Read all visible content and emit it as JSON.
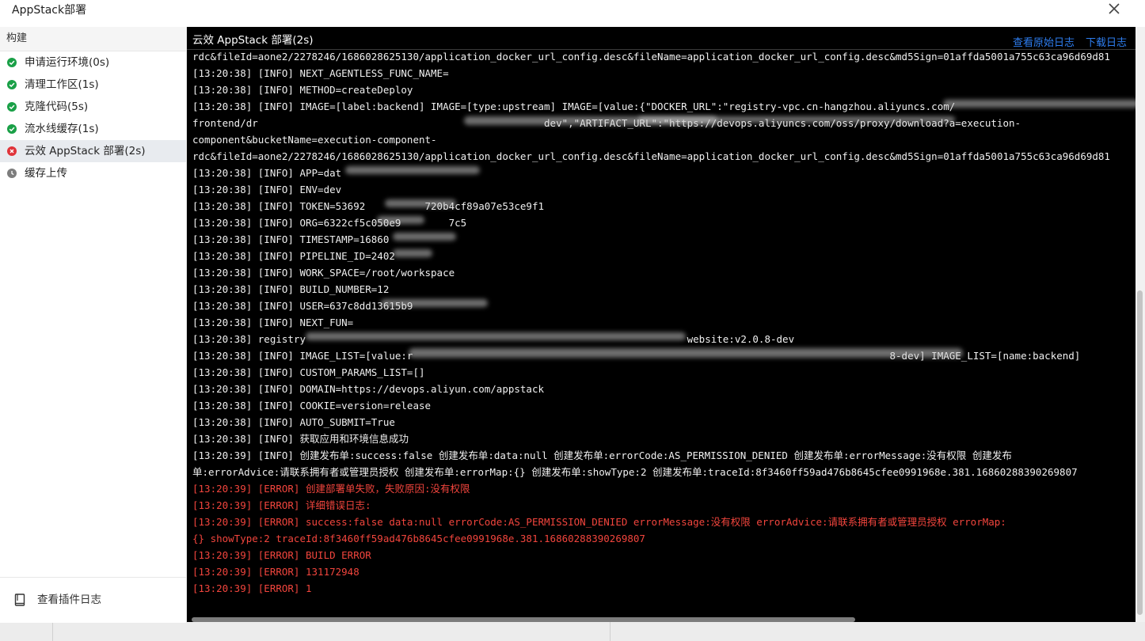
{
  "dialog": {
    "title": "AppStack部署"
  },
  "sidebar": {
    "header": "构建",
    "steps": [
      {
        "label": "申请运行环境(0s)",
        "status": "success"
      },
      {
        "label": "清理工作区(1s)",
        "status": "success"
      },
      {
        "label": "克隆代码(5s)",
        "status": "success"
      },
      {
        "label": "流水线缓存(1s)",
        "status": "success"
      },
      {
        "label": "云效 AppStack 部署(2s)",
        "status": "failed"
      },
      {
        "label": "缓存上传",
        "status": "pending"
      }
    ],
    "footer_link": "查看插件日志"
  },
  "log": {
    "title": "云效 AppStack 部署(2s)",
    "view_raw": "查看原始日志",
    "download": "下载日志",
    "lines": [
      {
        "text": "rdc&fileId=aone2/2278246/1686028625130/application_docker_url_config.desc&fileName=application_docker_url_config.desc&md5Sign=01affda5001a755c63ca96d69d81",
        "level": "info"
      },
      {
        "text": "[13:20:38] [INFO] NEXT_AGENTLESS_FUNC_NAME=",
        "level": "info"
      },
      {
        "text": "[13:20:38] [INFO] METHOD=createDeploy",
        "level": "info"
      },
      {
        "text": "[13:20:38] [INFO] IMAGE=[label:backend] IMAGE=[type:upstream] IMAGE=[value:{\"DOCKER_URL\":\"registry-vpc.cn-hangzhou.aliyuncs.com/",
        "level": "info"
      },
      {
        "text": "frontend/dr                                                dev\",\"ARTIFACT_URL\":\"https://devops.aliyuncs.com/oss/proxy/download?a=execution-",
        "level": "info"
      },
      {
        "text": "component&bucketName=execution-component-",
        "level": "info"
      },
      {
        "text": "rdc&fileId=aone2/2278246/1686028625130/application_docker_url_config.desc&fileName=application_docker_url_config.desc&md5Sign=01affda5001a755c63ca96d69d81",
        "level": "info"
      },
      {
        "text": "[13:20:38] [INFO] APP=dat",
        "level": "info"
      },
      {
        "text": "[13:20:38] [INFO] ENV=dev",
        "level": "info"
      },
      {
        "text": "[13:20:38] [INFO] TOKEN=53692          720b4cf89a07e53ce9f1",
        "level": "info"
      },
      {
        "text": "[13:20:38] [INFO] ORG=6322cf5c050e9        7c5",
        "level": "info"
      },
      {
        "text": "[13:20:38] [INFO] TIMESTAMP=16860",
        "level": "info"
      },
      {
        "text": "[13:20:38] [INFO] PIPELINE_ID=2402",
        "level": "info"
      },
      {
        "text": "[13:20:38] [INFO] WORK_SPACE=/root/workspace",
        "level": "info"
      },
      {
        "text": "[13:20:38] [INFO] BUILD_NUMBER=12",
        "level": "info"
      },
      {
        "text": "[13:20:38] [INFO] USER=637c8dd13615b9",
        "level": "info"
      },
      {
        "text": "[13:20:38] [INFO] NEXT_FUN=",
        "level": "info"
      },
      {
        "text": "[13:20:38] registry                                                                website:v2.0.8-dev",
        "level": "info"
      },
      {
        "text": "[13:20:38] [INFO] IMAGE_LIST=[value:r                                                                                8-dev] IMAGE_LIST=[name:backend]",
        "level": "info"
      },
      {
        "text": "[13:20:38] [INFO] CUSTOM_PARAMS_LIST=[]",
        "level": "info"
      },
      {
        "text": "[13:20:38] [INFO] DOMAIN=https://devops.aliyun.com/appstack",
        "level": "info"
      },
      {
        "text": "[13:20:38] [INFO] COOKIE=version=release",
        "level": "info"
      },
      {
        "text": "[13:20:38] [INFO] AUTO_SUBMIT=True",
        "level": "info"
      },
      {
        "text": "[13:20:38] [INFO] 获取应用和环境信息成功",
        "level": "info"
      },
      {
        "text": "[13:20:39] [INFO] 创建发布单:success:false 创建发布单:data:null 创建发布单:errorCode:AS_PERMISSION_DENIED 创建发布单:errorMessage:没有权限 创建发布",
        "level": "info"
      },
      {
        "text": "单:errorAdvice:请联系拥有者或管理员授权 创建发布单:errorMap:{} 创建发布单:showType:2 创建发布单:traceId:8f3460ff59ad476b8645cfee0991968e.381.16860288390269807",
        "level": "info"
      },
      {
        "text": "[13:20:39] [ERROR] 创建部署单失败，失败原因:没有权限",
        "level": "error"
      },
      {
        "text": "[13:20:39] [ERROR] 详细错误日志:",
        "level": "error"
      },
      {
        "text": "[13:20:39] [ERROR] success:false data:null errorCode:AS_PERMISSION_DENIED errorMessage:没有权限 errorAdvice:请联系拥有者或管理员授权 errorMap:",
        "level": "error"
      },
      {
        "text": "{} showType:2 traceId:8f3460ff59ad476b8645cfee0991968e.381.16860288390269807",
        "level": "error"
      },
      {
        "text": "[13:20:39] [ERROR] BUILD ERROR",
        "level": "error"
      },
      {
        "text": "[13:20:39] [ERROR] 131172948",
        "level": "error"
      },
      {
        "text": "[13:20:39] [ERROR] 1",
        "level": "error"
      }
    ]
  },
  "colors": {
    "success": "#1aa047",
    "failed": "#e0343a",
    "pending": "#7d7d7d",
    "link": "#2e7ef0",
    "error_text": "#f2453d"
  },
  "icons": {
    "success": "check-circle-icon",
    "failed": "close-circle-icon",
    "pending": "clock-icon",
    "close": "close-icon",
    "plugin_log": "document-icon"
  }
}
